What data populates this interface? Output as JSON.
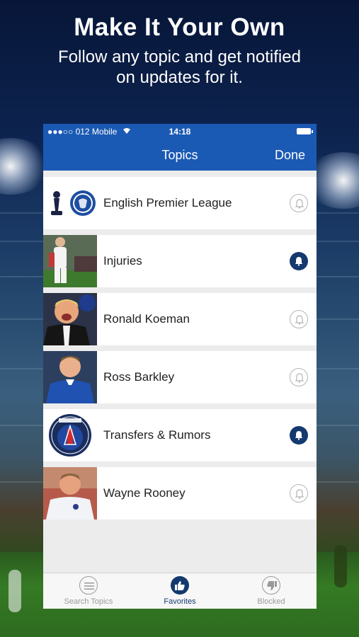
{
  "promo": {
    "title": "Make It Your Own",
    "subtitle_line1": "Follow any topic and get notified",
    "subtitle_line2": "on updates for it."
  },
  "status_bar": {
    "carrier": "●●●○○ 012 Mobile",
    "time": "14:18"
  },
  "nav": {
    "title": "Topics",
    "done_label": "Done"
  },
  "topics": [
    {
      "label": "English Premier League",
      "notifications": "off",
      "icon": "club-crests-icon"
    },
    {
      "label": "Injuries",
      "notifications": "on",
      "icon": "injured-player-photo"
    },
    {
      "label": "Ronald Koeman",
      "notifications": "off",
      "icon": "ronald-koeman-photo"
    },
    {
      "label": "Ross Barkley",
      "notifications": "off",
      "icon": "ross-barkley-photo"
    },
    {
      "label": "Transfers & Rumors",
      "notifications": "on",
      "icon": "psg-crest-icon"
    },
    {
      "label": "Wayne Rooney",
      "notifications": "off",
      "icon": "wayne-rooney-photo"
    }
  ],
  "tabs": [
    {
      "label": "Search Topics",
      "icon": "list-icon",
      "active": false
    },
    {
      "label": "Favorites",
      "icon": "thumbs-up-icon",
      "active": true
    },
    {
      "label": "Blocked",
      "icon": "thumbs-down-icon",
      "active": false
    }
  ],
  "colors": {
    "nav_blue": "#1b5ab4",
    "accent_navy": "#14396e",
    "list_background": "#ececec"
  }
}
